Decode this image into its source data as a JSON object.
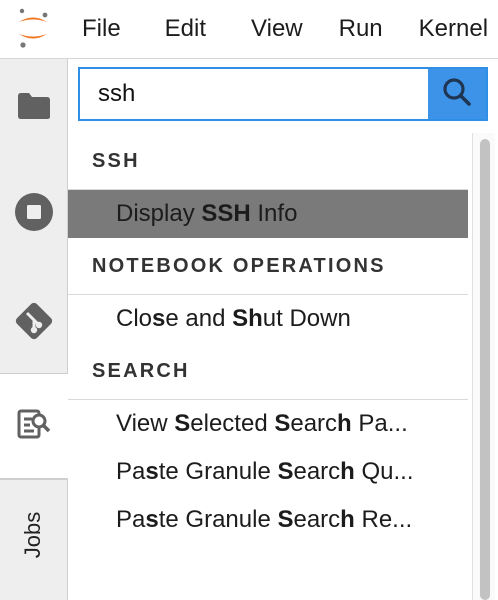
{
  "app": {
    "logo_icon": "jupyter-logo-icon",
    "accent_color": "#f37726"
  },
  "menu": {
    "items": [
      "File",
      "Edit",
      "View",
      "Run",
      "Kernel"
    ]
  },
  "sidebar": {
    "tabs": [
      {
        "icon": "folder-icon"
      },
      {
        "icon": "stop-circle-icon"
      },
      {
        "icon": "git-icon"
      },
      {
        "icon": "search-results-icon"
      },
      {
        "label": "Jobs"
      }
    ]
  },
  "search": {
    "value": "ssh",
    "button_icon": "magnifier-icon",
    "accent_color": "#3d93e8"
  },
  "results": {
    "groups": [
      {
        "title": "SSH",
        "items": [
          {
            "parts": [
              "Display ",
              "SSH",
              " Info"
            ],
            "selected": true
          }
        ]
      },
      {
        "title": "NOTEBOOK OPERATIONS",
        "items": [
          {
            "parts": [
              "Clo",
              "s",
              "e and ",
              "Sh",
              "ut Down"
            ]
          }
        ]
      },
      {
        "title": "SEARCH",
        "items": [
          {
            "parts": [
              "View ",
              "S",
              "elected ",
              "S",
              "earc",
              "h",
              " Pa..."
            ]
          },
          {
            "parts": [
              "Pa",
              "s",
              "te Granule ",
              "S",
              "earc",
              "h",
              " Qu..."
            ]
          },
          {
            "parts": [
              "Pa",
              "s",
              "te Granule ",
              "S",
              "earc",
              "h",
              " Re..."
            ]
          }
        ]
      }
    ]
  }
}
